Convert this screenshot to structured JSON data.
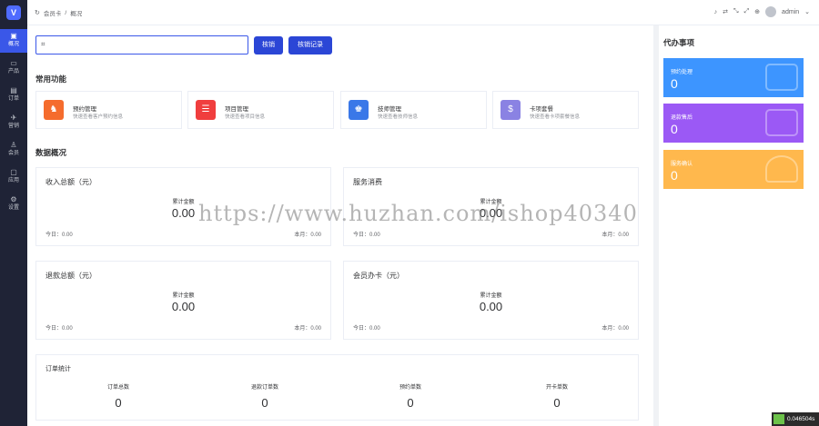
{
  "app": {
    "logo_glyph": "V"
  },
  "sidebar": {
    "items": [
      {
        "label": "概况",
        "icon": "dashboard-icon",
        "glyph": "▣",
        "active": true
      },
      {
        "label": "产品",
        "icon": "product-icon",
        "glyph": "▭"
      },
      {
        "label": "订单",
        "icon": "order-icon",
        "glyph": "▤"
      },
      {
        "label": "营销",
        "icon": "marketing-icon",
        "glyph": "✈"
      },
      {
        "label": "会员",
        "icon": "member-icon",
        "glyph": "♙"
      },
      {
        "label": "应用",
        "icon": "app-icon",
        "glyph": "▢"
      },
      {
        "label": "设置",
        "icon": "settings-icon",
        "glyph": "⚙"
      }
    ]
  },
  "header": {
    "breadcrumb": [
      "会员卡",
      "/",
      "概况"
    ],
    "user": "admin"
  },
  "search": {
    "placeholder": "",
    "value": ""
  },
  "buttons": {
    "verify": "核销",
    "records": "核销记录"
  },
  "sections": {
    "functions": "常用功能",
    "overview": "数据概况"
  },
  "functions": [
    {
      "name": "预约管理",
      "desc": "快速查看客户预约信息",
      "color": "#f56c2d",
      "icon": "appointment-icon",
      "glyph": "♞"
    },
    {
      "name": "项目管理",
      "desc": "快速查看项目信息",
      "color": "#f03e3e",
      "icon": "project-icon",
      "glyph": "☰"
    },
    {
      "name": "技师管理",
      "desc": "快速查看技师信息",
      "color": "#3a78e8",
      "icon": "technician-icon",
      "glyph": "♚"
    },
    {
      "name": "卡项套餐",
      "desc": "快速查看卡项套餐信息",
      "color": "#8a82e3",
      "icon": "card-package-icon",
      "glyph": "$"
    }
  ],
  "stats": [
    {
      "title": "收入总额（元）",
      "label": "累计金额",
      "value": "0.00",
      "today": "今日：0.00",
      "month": "本月：0.00"
    },
    {
      "title": "服务消费",
      "label": "累计金额",
      "value": "0.00",
      "today": "今日：0.00",
      "month": "本月：0.00"
    },
    {
      "title": "退款总额（元）",
      "label": "累计金额",
      "value": "0.00",
      "today": "今日：0.00",
      "month": "本月：0.00"
    },
    {
      "title": "会员办卡（元）",
      "label": "累计金额",
      "value": "0.00",
      "today": "今日：0.00",
      "month": "本月：0.00"
    }
  ],
  "orders": {
    "title": "订单统计",
    "columns": [
      {
        "label": "订单总数",
        "value": "0"
      },
      {
        "label": "退款订单数",
        "value": "0"
      },
      {
        "label": "预约单数",
        "value": "0"
      },
      {
        "label": "开卡单数",
        "value": "0"
      }
    ]
  },
  "todo": {
    "title": "代办事项",
    "items": [
      {
        "label": "预约处理",
        "value": "0",
        "color": "#3d95ff"
      },
      {
        "label": "退款售后",
        "value": "0",
        "color": "#9b59f5"
      },
      {
        "label": "服务确认",
        "value": "0",
        "color": "#ffb84d"
      }
    ]
  },
  "watermark": "https://www.huzhan.com/ishop40340",
  "perf": "0.046504s"
}
